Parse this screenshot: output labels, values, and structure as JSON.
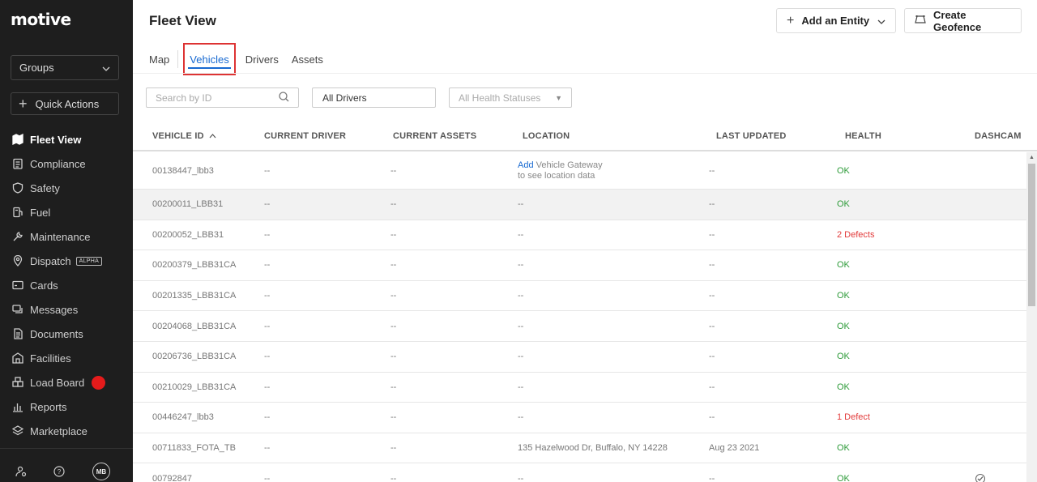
{
  "app": {
    "logo": "motive"
  },
  "sidebar": {
    "groups_label": "Groups",
    "quick_actions_label": "Quick Actions",
    "items": [
      {
        "label": "Fleet View",
        "icon": "map-icon",
        "active": true
      },
      {
        "label": "Compliance",
        "icon": "clipboard-icon"
      },
      {
        "label": "Safety",
        "icon": "shield-icon"
      },
      {
        "label": "Fuel",
        "icon": "fuel-icon"
      },
      {
        "label": "Maintenance",
        "icon": "wrench-icon"
      },
      {
        "label": "Dispatch",
        "icon": "location-pin-icon",
        "badge": "ALPHA"
      },
      {
        "label": "Cards",
        "icon": "card-icon"
      },
      {
        "label": "Messages",
        "icon": "chat-icon"
      },
      {
        "label": "Documents",
        "icon": "document-icon"
      },
      {
        "label": "Facilities",
        "icon": "building-icon"
      },
      {
        "label": "Load Board",
        "icon": "boxes-icon",
        "notification_dot": true
      },
      {
        "label": "Reports",
        "icon": "chart-icon"
      },
      {
        "label": "Marketplace",
        "icon": "layers-icon"
      }
    ],
    "footer": {
      "settings_icon": "user-settings-icon",
      "help_icon": "help-icon",
      "avatar_initials": "MB"
    }
  },
  "header": {
    "title": "Fleet View",
    "add_entity_label": "Add an Entity",
    "create_geofence_label": "Create Geofence"
  },
  "tabs": [
    {
      "label": "Map"
    },
    {
      "label": "Vehicles",
      "active": true
    },
    {
      "label": "Drivers"
    },
    {
      "label": "Assets"
    }
  ],
  "filters": {
    "search_placeholder": "Search by ID",
    "drivers_value": "All Drivers",
    "health_placeholder": "All Health Statuses"
  },
  "table": {
    "columns": [
      "VEHICLE ID",
      "CURRENT DRIVER",
      "CURRENT ASSETS",
      "LOCATION",
      "LAST UPDATED",
      "HEALTH",
      "DASHCAM"
    ],
    "sort_indicator": "^",
    "rows": [
      {
        "id": "00138447_lbb3",
        "driver": "--",
        "assets": "--",
        "location_link": "Add",
        "location": "Vehicle Gateway",
        "location_sub": "to see location data",
        "updated": "--",
        "health": "OK",
        "health_status": "ok",
        "dashcam": ""
      },
      {
        "id": "00200011_LBB31",
        "driver": "--",
        "assets": "--",
        "location": "--",
        "updated": "--",
        "health": "OK",
        "health_status": "ok",
        "dashcam": ""
      },
      {
        "id": "00200052_LBB31",
        "driver": "--",
        "assets": "--",
        "location": "--",
        "updated": "--",
        "health": "2 Defects",
        "health_status": "defect",
        "dashcam": ""
      },
      {
        "id": "00200379_LBB31CA",
        "driver": "--",
        "assets": "--",
        "location": "--",
        "updated": "--",
        "health": "OK",
        "health_status": "ok",
        "dashcam": ""
      },
      {
        "id": "00201335_LBB31CA",
        "driver": "--",
        "assets": "--",
        "location": "--",
        "updated": "--",
        "health": "OK",
        "health_status": "ok",
        "dashcam": ""
      },
      {
        "id": "00204068_LBB31CA",
        "driver": "--",
        "assets": "--",
        "location": "--",
        "updated": "--",
        "health": "OK",
        "health_status": "ok",
        "dashcam": ""
      },
      {
        "id": "00206736_LBB31CA",
        "driver": "--",
        "assets": "--",
        "location": "--",
        "updated": "--",
        "health": "OK",
        "health_status": "ok",
        "dashcam": ""
      },
      {
        "id": "00210029_LBB31CA",
        "driver": "--",
        "assets": "--",
        "location": "--",
        "updated": "--",
        "health": "OK",
        "health_status": "ok",
        "dashcam": ""
      },
      {
        "id": "00446247_lbb3",
        "driver": "--",
        "assets": "--",
        "location": "--",
        "updated": "--",
        "health": "1 Defect",
        "health_status": "defect",
        "dashcam": ""
      },
      {
        "id": "00711833_FOTA_TB",
        "driver": "--",
        "assets": "--",
        "location": "135 Hazelwood Dr, Buffalo, NY 14228",
        "updated": "Aug 23 2021",
        "health": "OK",
        "health_status": "ok",
        "dashcam": ""
      },
      {
        "id": "00792847",
        "driver": "--",
        "assets": "--",
        "location": "--",
        "updated": "--",
        "health": "OK",
        "health_status": "ok",
        "dashcam": "check-icon"
      }
    ]
  },
  "colors": {
    "sidebar_bg": "#1e1e1e",
    "accent": "#1769d1",
    "ok": "#2e9b3a",
    "defect": "#e23b3b",
    "highlight_box": "#dd3333"
  }
}
